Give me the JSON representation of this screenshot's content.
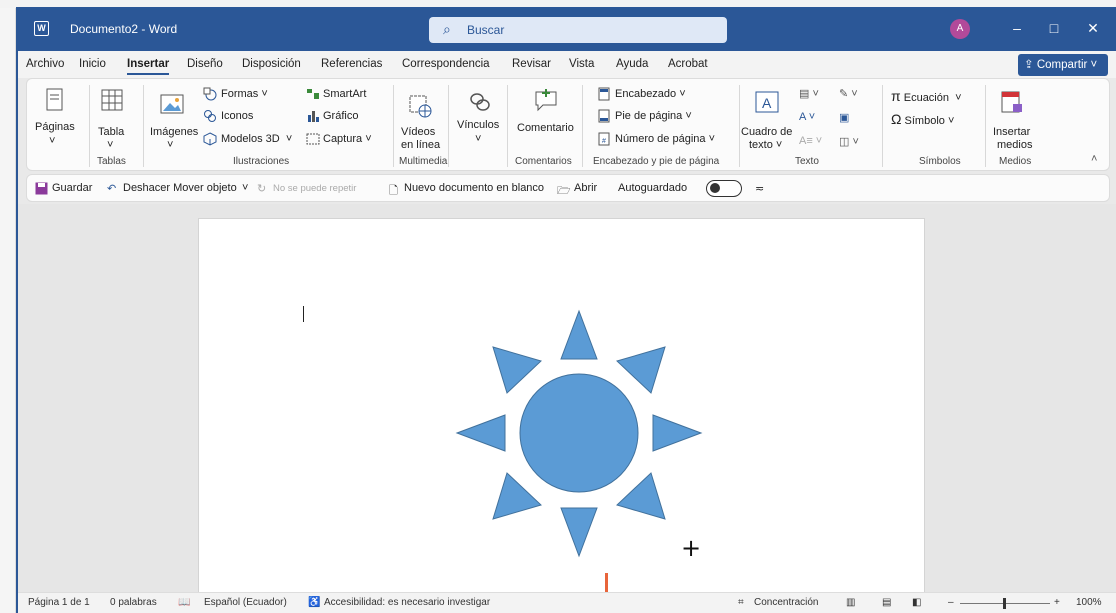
{
  "app": {
    "title": "Documento2 - Word",
    "search_placeholder": "Buscar",
    "avatar_initial": "A"
  },
  "menu": {
    "tabs": [
      "Archivo",
      "Inicio",
      "Insertar",
      "Diseño",
      "Disposición",
      "Referencias",
      "Correspondencia",
      "Revisar",
      "Vista",
      "Ayuda",
      "Acrobat"
    ],
    "active_tab": "Insertar",
    "share_label": "Compartir"
  },
  "ribbon": {
    "paginas": "Páginas",
    "tabla": "Tabla",
    "imagenes": "Imágenes",
    "formas": "Formas",
    "iconos": "Iconos",
    "modelos3d": "Modelos 3D",
    "smartart": "SmartArt",
    "grafico": "Gráfico",
    "captura": "Captura",
    "videos_l1": "Vídeos",
    "videos_l2": "en línea",
    "vinculos": "Vínculos",
    "comentario": "Comentario",
    "encabezado": "Encabezado",
    "pie": "Pie de página",
    "numero": "Número de página",
    "cuadro_l1": "Cuadro de",
    "cuadro_l2": "texto",
    "ecuacion": "Ecuación",
    "simbolo": "Símbolo",
    "insertar_l1": "Insertar",
    "insertar_l2": "medios",
    "groups": {
      "tablas": "Tablas",
      "ilustraciones": "Ilustraciones",
      "multimedia": "Multimedia",
      "comentarios": "Comentarios",
      "encabezado_pie": "Encabezado y pie de página",
      "texto": "Texto",
      "simbolos": "Símbolos",
      "medios": "Medios"
    }
  },
  "qat": {
    "guardar": "Guardar",
    "deshacer": "Deshacer Mover objeto",
    "rehacer": "No se puede repetir",
    "nuevo": "Nuevo documento en blanco",
    "abrir": "Abrir",
    "autoguardado": "Autoguardado"
  },
  "status": {
    "pagina": "Página 1 de 1",
    "palabras": "0 palabras",
    "idioma": "Español (Ecuador)",
    "accesibilidad": "Accesibilidad: es necesario investigar",
    "concentracion": "Concentración",
    "zoom": "100%"
  },
  "colors": {
    "titlebar": "#2b5797",
    "sun_fill": "#5b9bd5",
    "sun_stroke": "#41719c",
    "guide_line": "#e8653b"
  }
}
